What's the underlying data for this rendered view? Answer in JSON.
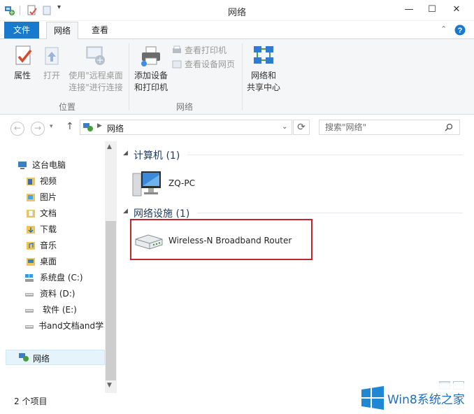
{
  "window": {
    "title": "网络",
    "minimize": "—",
    "maximize": "☐",
    "close": "✕"
  },
  "ribbon": {
    "tabs": {
      "file": "文件",
      "network": "网络",
      "view": "查看"
    },
    "location_group": {
      "label": "位置",
      "properties": "属性",
      "open": "打开",
      "remote_desktop_line1": "使用\"远程桌面",
      "remote_desktop_line2": "连接\"进行连接"
    },
    "network_group": {
      "label": "网络",
      "add_device_line1": "添加设备",
      "add_device_line2": "和打印机",
      "view_printers": "查看打印机",
      "view_device_webpage": "查看设备网页"
    },
    "sharing_center_line1": "网络和",
    "sharing_center_line2": "共享中心"
  },
  "address": {
    "path": "网络",
    "search_placeholder": "搜索\"网络\""
  },
  "nav_pane": {
    "this_pc": "这台电脑",
    "items": [
      "视频",
      "图片",
      "文档",
      "下载",
      "音乐",
      "桌面",
      "系统盘 (C:)",
      "资料 (D:)",
      "软件 (E:)",
      "书and文档and学"
    ],
    "network": "网络"
  },
  "content": {
    "groups": [
      {
        "header": "计算机 (1)",
        "items": [
          "ZQ-PC"
        ]
      },
      {
        "header": "网络设施 (1)",
        "items": [
          "Wireless-N Broadband Router"
        ]
      }
    ]
  },
  "status": {
    "item_count": "2 个项目"
  },
  "watermark": {
    "text": "Win8系统之家"
  },
  "colors": {
    "accent": "#1979ca",
    "highlight_border": "#c0262b",
    "header_text": "#1e395b"
  }
}
